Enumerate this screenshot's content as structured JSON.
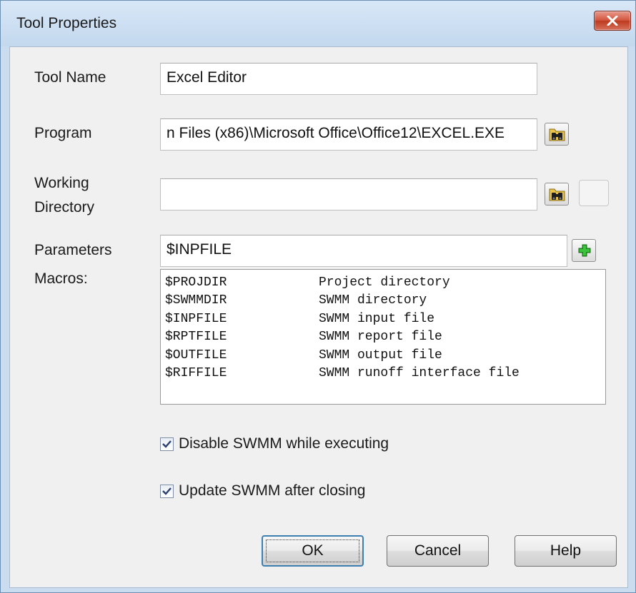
{
  "window": {
    "title": "Tool Properties",
    "close_icon": "close-icon"
  },
  "fields": {
    "tool_name": {
      "label": "Tool Name",
      "value": "Excel Editor"
    },
    "program": {
      "label": "Program",
      "value": "n Files (x86)\\Microsoft Office\\Office12\\EXCEL.EXE"
    },
    "working_directory": {
      "label_line1": "Working",
      "label_line2": "Directory",
      "value": ""
    },
    "parameters": {
      "label": "Parameters",
      "value": "$INPFILE"
    }
  },
  "macros": {
    "label": "Macros:",
    "items": [
      {
        "name": "$PROJDIR",
        "desc": "Project directory"
      },
      {
        "name": "$SWMMDIR",
        "desc": "SWMM directory"
      },
      {
        "name": "$INPFILE",
        "desc": "SWMM input file"
      },
      {
        "name": "$RPTFILE",
        "desc": "SWMM report file"
      },
      {
        "name": "$OUTFILE",
        "desc": "SWMM output file"
      },
      {
        "name": "$RIFFILE",
        "desc": "SWMM runoff interface file"
      }
    ]
  },
  "options": {
    "disable_swmm": {
      "label": "Disable SWMM while executing",
      "checked": true
    },
    "update_swmm": {
      "label": "Update SWMM after closing",
      "checked": true
    }
  },
  "buttons": {
    "ok": "OK",
    "cancel": "Cancel",
    "help": "Help"
  },
  "colors": {
    "title_bar": "#c3d8ee",
    "close_button": "#d2563d",
    "dialog_bg": "#f0f0f0",
    "default_button_border": "#3c7fb1"
  }
}
